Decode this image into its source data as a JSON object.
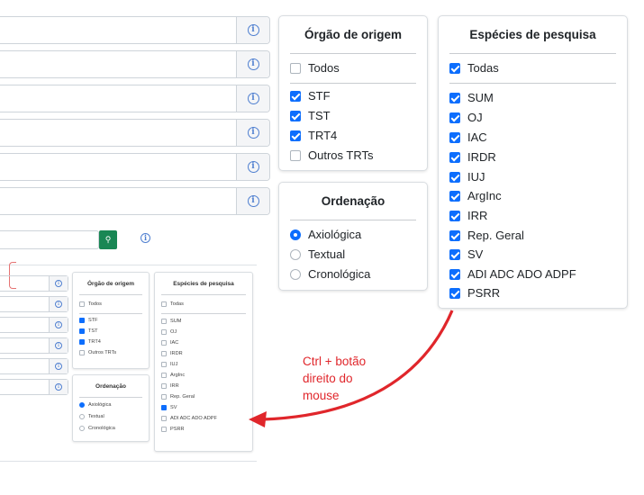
{
  "info_glyph": "i",
  "orgao": {
    "title": "Órgão de origem",
    "todos": {
      "label": "Todos",
      "checked": false
    },
    "items": [
      {
        "label": "STF",
        "checked": true
      },
      {
        "label": "TST",
        "checked": true
      },
      {
        "label": "TRT4",
        "checked": true
      },
      {
        "label": "Outros TRTs",
        "checked": false
      }
    ]
  },
  "ordenacao": {
    "title": "Ordenação",
    "options": [
      {
        "label": "Axiológica",
        "selected": true
      },
      {
        "label": "Textual",
        "selected": false
      },
      {
        "label": "Cronológica",
        "selected": false
      }
    ]
  },
  "especies": {
    "title": "Espécies de pesquisa",
    "todas": {
      "label": "Todas",
      "checked": true
    },
    "items": [
      {
        "label": "SUM",
        "checked": true
      },
      {
        "label": "OJ",
        "checked": true
      },
      {
        "label": "IAC",
        "checked": true
      },
      {
        "label": "IRDR",
        "checked": true
      },
      {
        "label": "IUJ",
        "checked": true
      },
      {
        "label": "ArgInc",
        "checked": true
      },
      {
        "label": "IRR",
        "checked": true
      },
      {
        "label": "Rep. Geral",
        "checked": true
      },
      {
        "label": "SV",
        "checked": true
      },
      {
        "label": "ADI ADC ADO ADPF",
        "checked": true
      },
      {
        "label": "PSRR",
        "checked": true
      }
    ]
  },
  "mini": {
    "search_icon": "search-icon",
    "search_glyph": "⚲",
    "orgao": {
      "title": "Órgão de origem",
      "todos": "Todos",
      "items": [
        {
          "label": "STF",
          "checked": true
        },
        {
          "label": "TST",
          "checked": true
        },
        {
          "label": "TRT4",
          "checked": true
        },
        {
          "label": "Outros TRTs",
          "checked": false
        }
      ]
    },
    "ordenacao": {
      "title": "Ordenação",
      "options": [
        {
          "label": "Axiológica",
          "selected": true
        },
        {
          "label": "Textual",
          "selected": false
        },
        {
          "label": "Cronológica",
          "selected": false
        }
      ]
    },
    "especies": {
      "title": "Espécies de pesquisa",
      "todas": "Todas",
      "items": [
        {
          "label": "SUM",
          "checked": false
        },
        {
          "label": "OJ",
          "checked": false
        },
        {
          "label": "IAC",
          "checked": false
        },
        {
          "label": "IRDR",
          "checked": false
        },
        {
          "label": "IUJ",
          "checked": false
        },
        {
          "label": "ArgInc",
          "checked": false
        },
        {
          "label": "IRR",
          "checked": false
        },
        {
          "label": "Rep. Geral",
          "checked": false
        },
        {
          "label": "SV",
          "checked": true
        },
        {
          "label": "ADI ADC ADO ADPF",
          "checked": false
        },
        {
          "label": "PSRR",
          "checked": false
        }
      ]
    }
  },
  "annotation": {
    "lines": [
      "Ctrl + botão",
      "direito do",
      "mouse"
    ],
    "color": "#e0262b"
  },
  "colors": {
    "accent": "#0d6efd",
    "search_button": "#198754",
    "annotation": "#e0262b"
  }
}
